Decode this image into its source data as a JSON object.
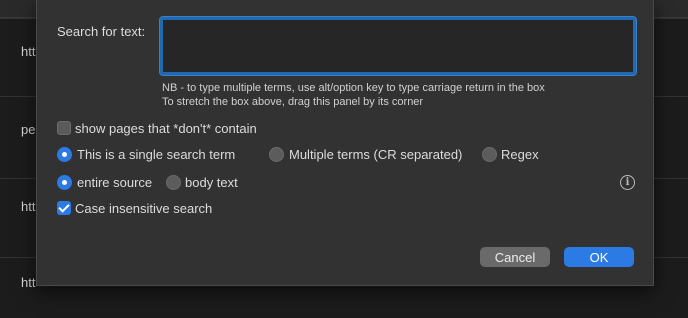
{
  "background": {
    "rows": [
      "htt",
      "pe",
      "htt",
      "htt"
    ]
  },
  "dialog": {
    "search_label": "Search for text:",
    "search_value": "",
    "hint_line1": "NB - to type multiple terms, use alt/option key to type carriage return in the box",
    "hint_line2": "To stretch the box above, drag this panel by its corner",
    "dont_contain_label": "show pages that *don't* contain",
    "dont_contain_checked": false,
    "term_mode": {
      "single_label": "This is a single search term",
      "multiple_label": "Multiple terms (CR separated)",
      "regex_label": "Regex",
      "selected": "single"
    },
    "scope": {
      "source_label": "entire source",
      "body_label": "body text",
      "selected": "source"
    },
    "case_label": "Case insensitive search",
    "case_checked": true,
    "cancel_label": "Cancel",
    "ok_label": "OK"
  },
  "colors": {
    "accent": "#2c7be5",
    "sheet_bg": "#323232",
    "field_border": "#1f6ab0"
  },
  "icons": [
    "info-icon"
  ]
}
